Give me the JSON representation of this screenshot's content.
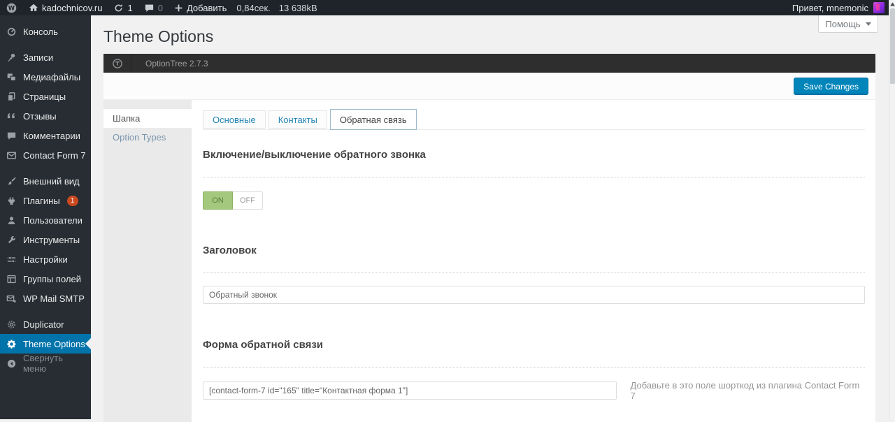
{
  "admin_bar": {
    "site_name": "kadochnicov.ru",
    "updates_count": "1",
    "comments_count": "0",
    "add_new_label": "Добавить",
    "load_time": "0,84сек.",
    "memory": "13 638kB",
    "greeting": "Привет, mnemonic"
  },
  "sidebar": {
    "items": [
      {
        "label": "Консоль"
      },
      {
        "label": "Записи"
      },
      {
        "label": "Медиафайлы"
      },
      {
        "label": "Страницы"
      },
      {
        "label": "Отзывы"
      },
      {
        "label": "Комментарии"
      },
      {
        "label": "Contact Form 7"
      },
      {
        "label": "Внешний вид"
      },
      {
        "label": "Плагины",
        "badge": "1"
      },
      {
        "label": "Пользователи"
      },
      {
        "label": "Инструменты"
      },
      {
        "label": "Настройки"
      },
      {
        "label": "Группы полей"
      },
      {
        "label": "WP Mail SMTP"
      },
      {
        "label": "Duplicator"
      },
      {
        "label": "Theme Options",
        "active": true
      },
      {
        "label": "Свернуть меню"
      }
    ]
  },
  "page": {
    "title": "Theme Options",
    "help_label": "Помощь"
  },
  "optiontree": {
    "version_title": "OptionTree 2.7.3",
    "save_button_label": "Save Changes",
    "side_nav": [
      {
        "label": "Шапка",
        "active": true
      },
      {
        "label": "Option Types",
        "active": false
      }
    ],
    "tabs": [
      {
        "label": "Основные",
        "active": false
      },
      {
        "label": "Контакты",
        "active": false
      },
      {
        "label": "Обратная связь",
        "active": true
      }
    ],
    "sections": [
      {
        "heading": "Включение/выключение обратного звонка",
        "control": "toggle",
        "on_label": "ON",
        "off_label": "OFF",
        "value": "on"
      },
      {
        "heading": "Заголовок",
        "control": "text",
        "value": "Обратный звонок"
      },
      {
        "heading": "Форма обратной связи",
        "control": "text",
        "value": "[contact-form-7 id=\"165\" title=\"Контактная форма 1\"]",
        "hint": "Добавьте в это поле шорткод из плагина Contact Form 7"
      }
    ]
  },
  "colors": {
    "admin_bar_bg": "#1f242a",
    "sidebar_bg": "#282d33",
    "active_menu_blue": "#0073aa",
    "save_button_blue": "#0085ba",
    "toggle_on_green": "#a3c87e",
    "plugins_badge_red": "#ca4a1f",
    "page_bg": "#f1f1f1"
  }
}
